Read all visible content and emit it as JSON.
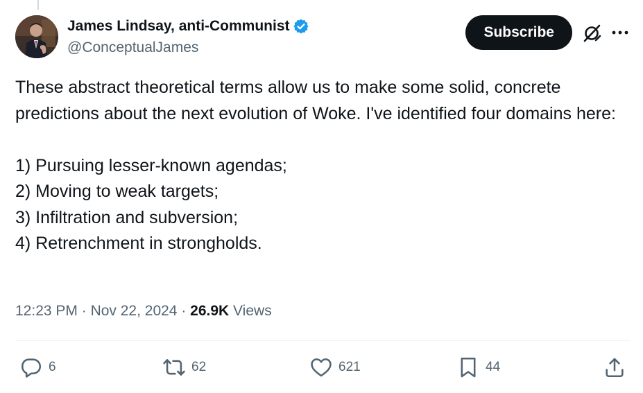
{
  "author": {
    "display_name": "James Lindsay, anti-Communist",
    "handle": "@ConceptualJames",
    "verified": true,
    "badge_color": "#1d9bf0"
  },
  "header": {
    "subscribe_label": "Subscribe",
    "grok_icon": "grok-icon",
    "more_icon": "more-icon"
  },
  "tweet": {
    "text_lines": [
      "These abstract theoretical terms allow us to make some solid, concrete predictions about the next evolution of Woke. I've identified four domains here:",
      "",
      "1) Pursuing lesser-known agendas;",
      "2) Moving to weak targets;",
      "3) Infiltration and subversion;",
      "4) Retrenchment in strongholds."
    ]
  },
  "meta": {
    "time": "12:23 PM",
    "separator": " · ",
    "date": "Nov 22, 2024",
    "views_count": "26.9K",
    "views_label": " Views"
  },
  "actions": {
    "reply_count": "6",
    "repost_count": "62",
    "like_count": "621",
    "bookmark_count": "44"
  },
  "colors": {
    "text_primary": "#0f1419",
    "text_secondary": "#536471",
    "subscribe_bg": "#0f1419",
    "divider": "#eff3f4"
  }
}
